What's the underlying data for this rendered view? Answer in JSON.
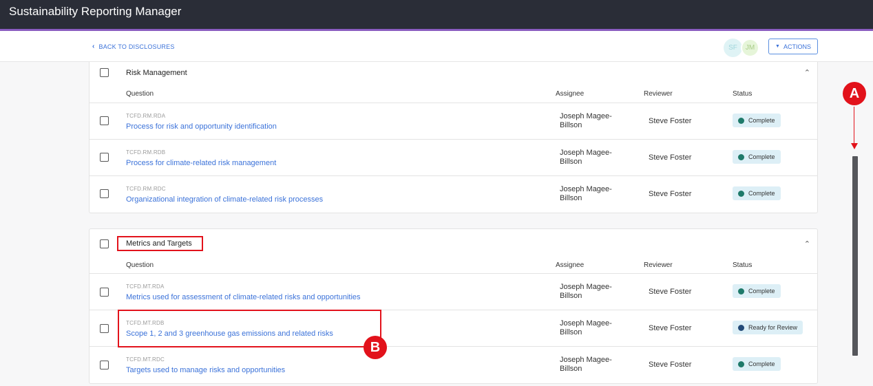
{
  "app": {
    "title": "Sustainability Reporting Manager"
  },
  "subheader": {
    "back_label": "BACK TO DISCLOSURES",
    "avatars": [
      "SF",
      "JM"
    ],
    "actions_label": "ACTIONS"
  },
  "columns": {
    "question": "Question",
    "assignee": "Assignee",
    "reviewer": "Reviewer",
    "status": "Status"
  },
  "sections": [
    {
      "title": "Risk Management",
      "rows": [
        {
          "code": "TCFD.RM.RDA",
          "question": "Process for risk and opportunity identification",
          "assignee_line1": "Joseph Magee-",
          "assignee_line2": "Billson",
          "reviewer": "Steve Foster",
          "status": "Complete"
        },
        {
          "code": "TCFD.RM.RDB",
          "question": "Process for climate-related risk management",
          "assignee_line1": "Joseph Magee-",
          "assignee_line2": "Billson",
          "reviewer": "Steve Foster",
          "status": "Complete"
        },
        {
          "code": "TCFD.RM.RDC",
          "question": "Organizational integration of climate-related risk processes",
          "assignee_line1": "Joseph Magee-",
          "assignee_line2": "Billson",
          "reviewer": "Steve Foster",
          "status": "Complete"
        }
      ]
    },
    {
      "title": "Metrics and Targets",
      "rows": [
        {
          "code": "TCFD.MT.RDA",
          "question": "Metrics used for assessment of climate-related risks and opportunities",
          "assignee_line1": "Joseph Magee-",
          "assignee_line2": "Billson",
          "reviewer": "Steve Foster",
          "status": "Complete"
        },
        {
          "code": "TCFD.MT.RDB",
          "question": "Scope 1, 2 and 3 greenhouse gas emissions and related risks",
          "assignee_line1": "Joseph Magee-",
          "assignee_line2": "Billson",
          "reviewer": "Steve Foster",
          "status": "Ready for Review"
        },
        {
          "code": "TCFD.MT.RDC",
          "question": "Targets used to manage risks and opportunities",
          "assignee_line1": "Joseph Magee-",
          "assignee_line2": "Billson",
          "reviewer": "Steve Foster",
          "status": "Complete"
        }
      ]
    }
  ],
  "annotations": {
    "marker_a": "A",
    "marker_b": "B"
  },
  "colors": {
    "complete": "#1f7a6a",
    "ready_for_review": "#234a78",
    "highlight": "#e2121b",
    "link": "#3b72d9"
  }
}
